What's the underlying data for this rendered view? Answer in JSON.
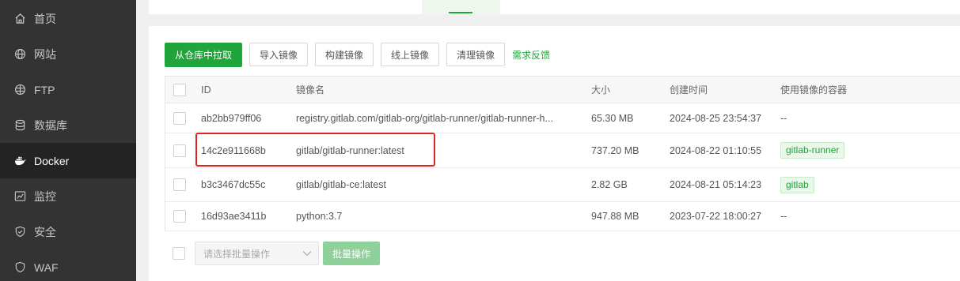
{
  "sidebar": {
    "items": [
      {
        "label": "首页",
        "icon": "home-icon"
      },
      {
        "label": "网站",
        "icon": "globe-icon"
      },
      {
        "label": "FTP",
        "icon": "ftp-globe-icon"
      },
      {
        "label": "数据库",
        "icon": "database-icon"
      },
      {
        "label": "Docker",
        "icon": "docker-icon",
        "active": true
      },
      {
        "label": "监控",
        "icon": "monitor-icon"
      },
      {
        "label": "安全",
        "icon": "shield-icon"
      },
      {
        "label": "WAF",
        "icon": "waf-shield-icon"
      }
    ]
  },
  "toolbar": {
    "pull_label": "从仓库中拉取",
    "import_label": "导入镜像",
    "build_label": "构建镜像",
    "online_label": "线上镜像",
    "clean_label": "清理镜像",
    "feedback_label": "需求反馈"
  },
  "table": {
    "columns": [
      "ID",
      "镜像名",
      "大小",
      "创建时间",
      "使用镜像的容器"
    ],
    "rows": [
      {
        "id": "ab2bb979ff06",
        "name": "registry.gitlab.com/gitlab-org/gitlab-runner/gitlab-runner-h...",
        "size": "65.30 MB",
        "created": "2024-08-25 23:54:37",
        "containers": "--"
      },
      {
        "id": "14c2e911668b",
        "name": "gitlab/gitlab-runner:latest",
        "size": "737.20 MB",
        "created": "2024-08-22 01:10:55",
        "containers": "gitlab-runner"
      },
      {
        "id": "b3c3467dc55c",
        "name": "gitlab/gitlab-ce:latest",
        "size": "2.82 GB",
        "created": "2024-08-21 05:14:23",
        "containers": "gitlab"
      },
      {
        "id": "16d93ae3411b",
        "name": "python:3.7",
        "size": "947.88 MB",
        "created": "2023-07-22 18:00:27",
        "containers": "--"
      }
    ]
  },
  "footer": {
    "batch_select_placeholder": "请选择批量操作",
    "batch_button_label": "批量操作"
  },
  "colors": {
    "accent": "#20a53a",
    "sidebar_bg": "#333333",
    "highlight": "#e0251b"
  }
}
